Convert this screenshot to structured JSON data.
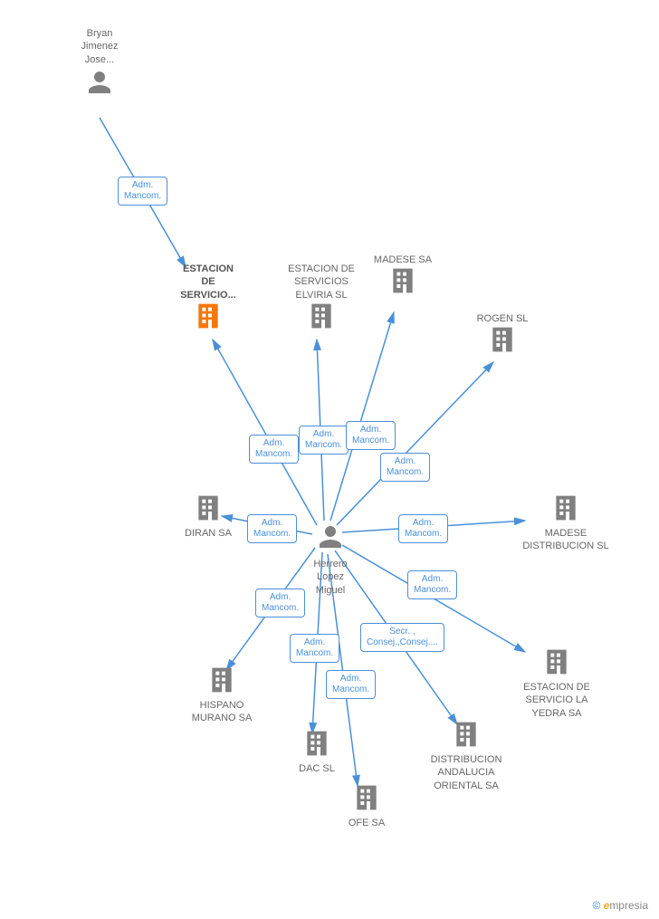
{
  "nodes": {
    "bryan": {
      "label": "Bryan\nJimenez\nJose...",
      "type": "person",
      "color": "#808080"
    },
    "estacion_servicio": {
      "label": "ESTACION\nDE\nSERVICIO...",
      "type": "building",
      "color": "#f5770a",
      "bold": true
    },
    "estacion_elviria": {
      "label": "ESTACION DE\nSERVICIOS\nELVIRIA SL",
      "type": "building",
      "color": "#808080"
    },
    "madese_sa": {
      "label": "MADESE SA",
      "type": "building",
      "color": "#808080"
    },
    "rogen": {
      "label": "ROGEN SL",
      "type": "building",
      "color": "#808080"
    },
    "diran": {
      "label": "DIRAN SA",
      "type": "building",
      "color": "#808080"
    },
    "madese_dist": {
      "label": "MADESE\nDISTRIBUCION SL",
      "type": "building",
      "color": "#808080"
    },
    "herrero": {
      "label": "Herrero\nLopez\nMiguel",
      "type": "person",
      "color": "#808080"
    },
    "hispano": {
      "label": "HISPANO\nMURANO SA",
      "type": "building",
      "color": "#808080"
    },
    "estacion_yedra": {
      "label": "ESTACION DE\nSERVICIO LA\nYEDRA SA",
      "type": "building",
      "color": "#808080"
    },
    "dac": {
      "label": "DAC SL",
      "type": "building",
      "color": "#808080"
    },
    "distribucion_and": {
      "label": "DISTRIBUCION\nANDALUCIA\nORIENTAL SA",
      "type": "building",
      "color": "#808080"
    },
    "ofe": {
      "label": "OFE SA",
      "type": "building",
      "color": "#808080"
    }
  },
  "edges": {
    "bryan_estacion": "Adm.\nMancom.",
    "herrero_estacion": "Adm.\nMancom.",
    "herrero_elviria": "Adm.\nMancom.",
    "herrero_madese_sa": "Adm.\nMancom.",
    "herrero_rogen": "Adm.\nMancom.",
    "herrero_diran": "Adm.\nMancom.",
    "herrero_madese_dist": "Adm.\nMancom.",
    "herrero_hispano": "Adm.\nMancom.",
    "herrero_yedra": "Adm.\nMancom.",
    "herrero_dac": "Adm.\nMancom.",
    "herrero_dist_and": "Secr. ,\nConsej.,Consej....",
    "herrero_ofe": "Adm.\nMancom."
  },
  "footer": {
    "copyright": "©",
    "brand_e": "e",
    "brand_rest": "mpresia"
  }
}
